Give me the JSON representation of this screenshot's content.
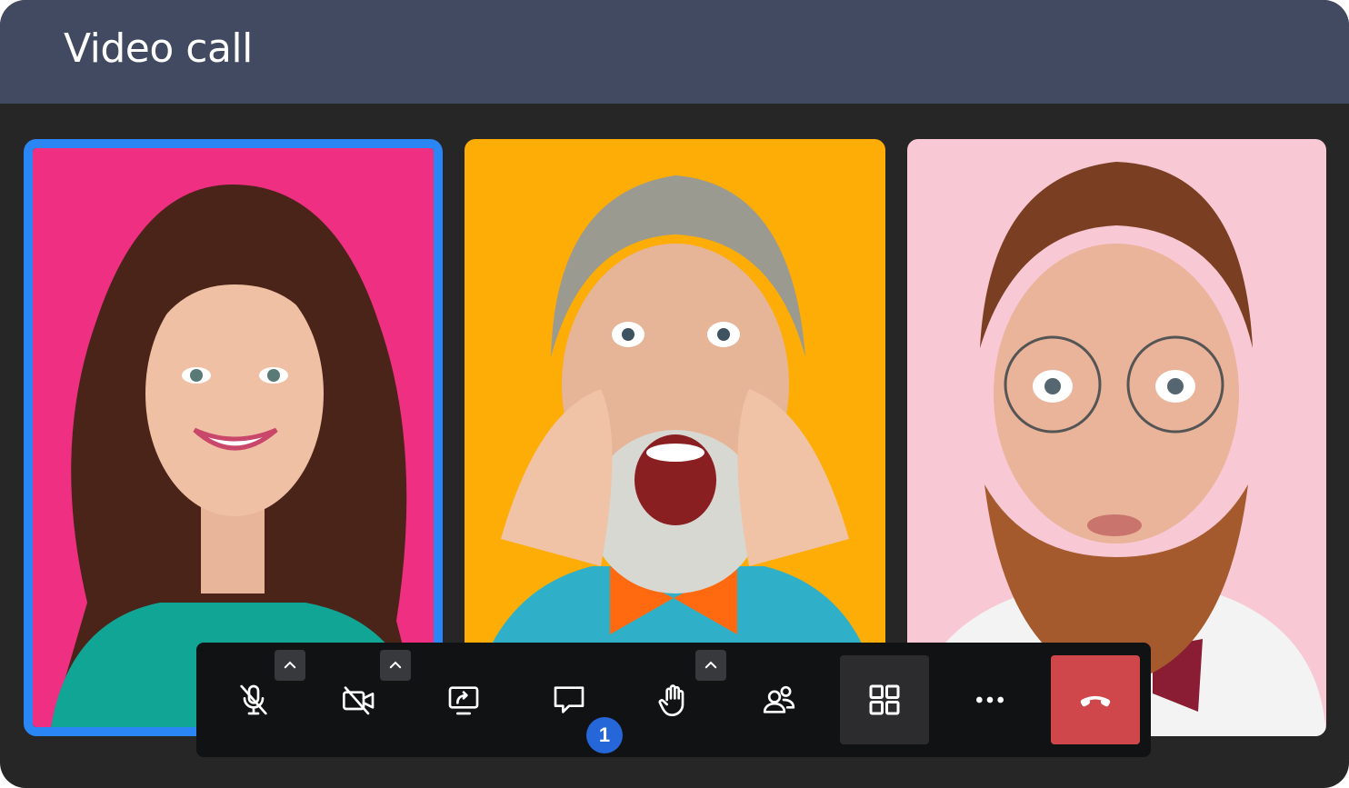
{
  "window": {
    "title": "Video call"
  },
  "colors": {
    "titlebar": "#414a60",
    "stage": "#262626",
    "active_speaker_border": "#2a86f5",
    "toolbar": "#111214",
    "end_call": "#d0474b",
    "badge": "#2566d8"
  },
  "participants": [
    {
      "background": "#ee2f82",
      "active_speaker": true
    },
    {
      "background": "#fdad06",
      "active_speaker": false
    },
    {
      "background": "#f8c8d4",
      "active_speaker": false
    }
  ],
  "toolbar": {
    "buttons": [
      {
        "id": "microphone",
        "icon": "mic-off-icon",
        "state": "muted",
        "has_options": true
      },
      {
        "id": "camera",
        "icon": "video-off-icon",
        "state": "off",
        "has_options": true
      },
      {
        "id": "share-screen",
        "icon": "share-screen-icon"
      },
      {
        "id": "chat",
        "icon": "chat-icon",
        "badge": "1"
      },
      {
        "id": "raise-hand",
        "icon": "hand-icon",
        "has_options": true
      },
      {
        "id": "participants",
        "icon": "people-icon"
      },
      {
        "id": "layout",
        "icon": "grid-icon",
        "state": "active"
      },
      {
        "id": "more",
        "icon": "more-icon"
      },
      {
        "id": "end-call",
        "icon": "phone-hangup-icon"
      }
    ]
  }
}
